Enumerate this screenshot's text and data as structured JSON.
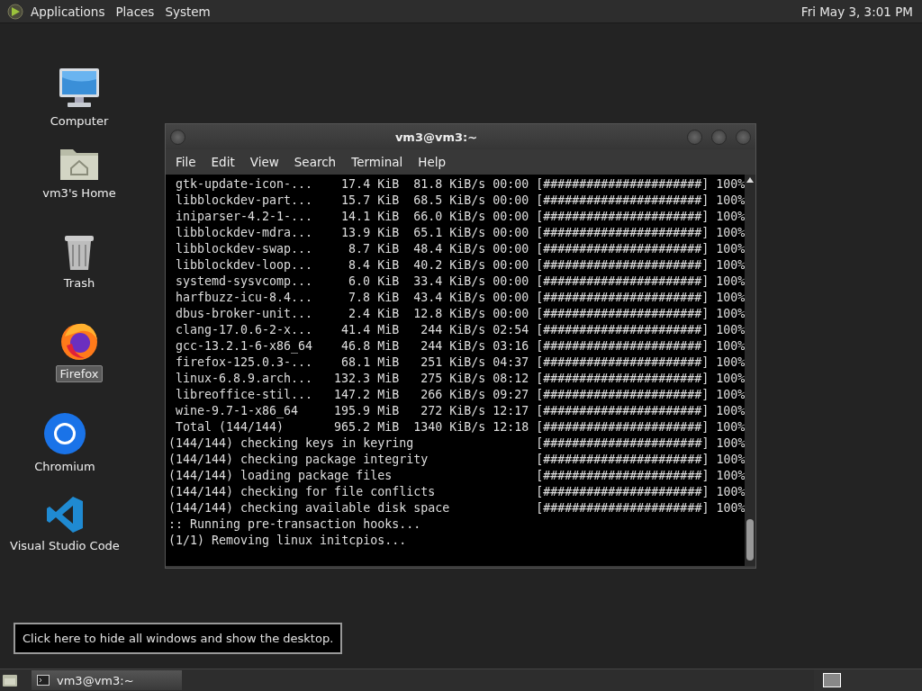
{
  "top_panel": {
    "menus": [
      "Applications",
      "Places",
      "System"
    ],
    "clock": "Fri May 3, 3:01 PM"
  },
  "desktop_icons": [
    {
      "kind": "computer",
      "label": "Computer",
      "selected": false
    },
    {
      "kind": "home",
      "label": "vm3's Home",
      "selected": false
    },
    {
      "kind": "trash",
      "label": "Trash",
      "selected": false
    },
    {
      "kind": "firefox",
      "label": "Firefox",
      "selected": true
    },
    {
      "kind": "chromium",
      "label": "Chromium",
      "selected": false
    },
    {
      "kind": "vscode",
      "label": "Visual Studio Code",
      "selected": false
    }
  ],
  "terminal_window": {
    "title": "vm3@vm3:~",
    "menu": [
      "File",
      "Edit",
      "View",
      "Search",
      "Terminal",
      "Help"
    ],
    "lines": [
      {
        "kind": "download",
        "name": "gtk-update-icon-...",
        "size": "17.4 KiB",
        "rate": "81.8 KiB/s",
        "time": "00:00",
        "bar": "[######################]",
        "pct": "100%"
      },
      {
        "kind": "download",
        "name": "libblockdev-part...",
        "size": "15.7 KiB",
        "rate": "68.5 KiB/s",
        "time": "00:00",
        "bar": "[######################]",
        "pct": "100%"
      },
      {
        "kind": "download",
        "name": "iniparser-4.2-1-...",
        "size": "14.1 KiB",
        "rate": "66.0 KiB/s",
        "time": "00:00",
        "bar": "[######################]",
        "pct": "100%"
      },
      {
        "kind": "download",
        "name": "libblockdev-mdra...",
        "size": "13.9 KiB",
        "rate": "65.1 KiB/s",
        "time": "00:00",
        "bar": "[######################]",
        "pct": "100%"
      },
      {
        "kind": "download",
        "name": "libblockdev-swap...",
        "size": "8.7 KiB",
        "rate": "48.4 KiB/s",
        "time": "00:00",
        "bar": "[######################]",
        "pct": "100%"
      },
      {
        "kind": "download",
        "name": "libblockdev-loop...",
        "size": "8.4 KiB",
        "rate": "40.2 KiB/s",
        "time": "00:00",
        "bar": "[######################]",
        "pct": "100%"
      },
      {
        "kind": "download",
        "name": "systemd-sysvcomp...",
        "size": "6.0 KiB",
        "rate": "33.4 KiB/s",
        "time": "00:00",
        "bar": "[######################]",
        "pct": "100%"
      },
      {
        "kind": "download",
        "name": "harfbuzz-icu-8.4...",
        "size": "7.8 KiB",
        "rate": "43.4 KiB/s",
        "time": "00:00",
        "bar": "[######################]",
        "pct": "100%"
      },
      {
        "kind": "download",
        "name": "dbus-broker-unit...",
        "size": "2.4 KiB",
        "rate": "12.8 KiB/s",
        "time": "00:00",
        "bar": "[######################]",
        "pct": "100%"
      },
      {
        "kind": "download",
        "name": "clang-17.0.6-2-x...",
        "size": "41.4 MiB",
        "rate": "244 KiB/s",
        "time": "02:54",
        "bar": "[######################]",
        "pct": "100%"
      },
      {
        "kind": "download",
        "name": "gcc-13.2.1-6-x86_64",
        "size": "46.8 MiB",
        "rate": "244 KiB/s",
        "time": "03:16",
        "bar": "[######################]",
        "pct": "100%"
      },
      {
        "kind": "download",
        "name": "firefox-125.0.3-...",
        "size": "68.1 MiB",
        "rate": "251 KiB/s",
        "time": "04:37",
        "bar": "[######################]",
        "pct": "100%"
      },
      {
        "kind": "download",
        "name": "linux-6.8.9.arch...",
        "size": "132.3 MiB",
        "rate": "275 KiB/s",
        "time": "08:12",
        "bar": "[######################]",
        "pct": "100%"
      },
      {
        "kind": "download",
        "name": "libreoffice-stil...",
        "size": "147.2 MiB",
        "rate": "266 KiB/s",
        "time": "09:27",
        "bar": "[######################]",
        "pct": "100%"
      },
      {
        "kind": "download",
        "name": "wine-9.7-1-x86_64",
        "size": "195.9 MiB",
        "rate": "272 KiB/s",
        "time": "12:17",
        "bar": "[######################]",
        "pct": "100%"
      },
      {
        "kind": "download",
        "name": "Total (144/144)",
        "size": "965.2 MiB",
        "rate": "1340 KiB/s",
        "time": "12:18",
        "bar": "[######################]",
        "pct": "100%"
      },
      {
        "kind": "step",
        "text": "(144/144) checking keys in keyring",
        "bar": "[######################]",
        "pct": "100%"
      },
      {
        "kind": "step",
        "text": "(144/144) checking package integrity",
        "bar": "[######################]",
        "pct": "100%"
      },
      {
        "kind": "step",
        "text": "(144/144) loading package files",
        "bar": "[######################]",
        "pct": "100%"
      },
      {
        "kind": "step",
        "text": "(144/144) checking for file conflicts",
        "bar": "[######################]",
        "pct": "100%"
      },
      {
        "kind": "step",
        "text": "(144/144) checking available disk space",
        "bar": "[######################]",
        "pct": "100%"
      },
      {
        "kind": "text",
        "text": ":: Running pre-transaction hooks..."
      },
      {
        "kind": "text",
        "text": "(1/1) Removing linux initcpios..."
      }
    ]
  },
  "tooltip": "Click here to hide all windows and show the desktop.",
  "bottom_panel": {
    "tasks": [
      {
        "title": "vm3@vm3:~",
        "selected": false
      }
    ]
  }
}
